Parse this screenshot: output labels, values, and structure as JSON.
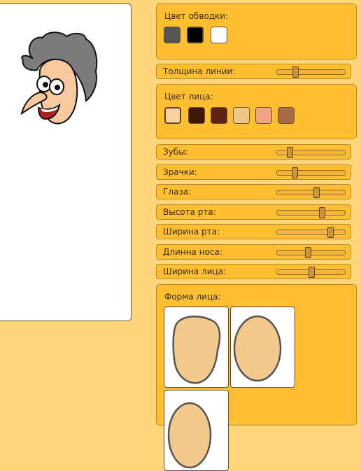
{
  "outline_color": {
    "label": "Цвет обводки:",
    "swatches": [
      "#555555",
      "#000000",
      "#ffffff"
    ],
    "selected": 1
  },
  "line_thickness": {
    "label": "Толщина линии:",
    "value": 0.27
  },
  "face_color": {
    "label": "Цвет лица:",
    "swatches": [
      "#fccf9f",
      "#3e1705",
      "#5f2411",
      "#f0c886",
      "#f2a283",
      "#a66b44"
    ],
    "selected": 0
  },
  "sliders": [
    {
      "label": "Зубы:",
      "value": 0.19
    },
    {
      "label": "Зрачки:",
      "value": 0.26
    },
    {
      "label": "Глаза:",
      "value": 0.58
    },
    {
      "label": "Высота рта:",
      "value": 0.66
    },
    {
      "label": "Ширина рта:",
      "value": 0.78
    },
    {
      "label": "Длинна носа:",
      "value": 0.45
    },
    {
      "label": "Ширина лица:",
      "value": 0.51
    }
  ],
  "face_shape": {
    "label": "Форма лица:",
    "shapes": [
      "irregular",
      "oval",
      "round"
    ],
    "selected": 0
  },
  "colors": {
    "background": "#ffd67a",
    "panel": "#ffbf30",
    "shape_fill": "#f2c98a",
    "shape_stroke": "#555555",
    "hair": "#7b7b7b",
    "lips": "#b22222"
  },
  "icons": {
    "face": "cartoon-face-icon",
    "shape": "face-shape-icon"
  }
}
